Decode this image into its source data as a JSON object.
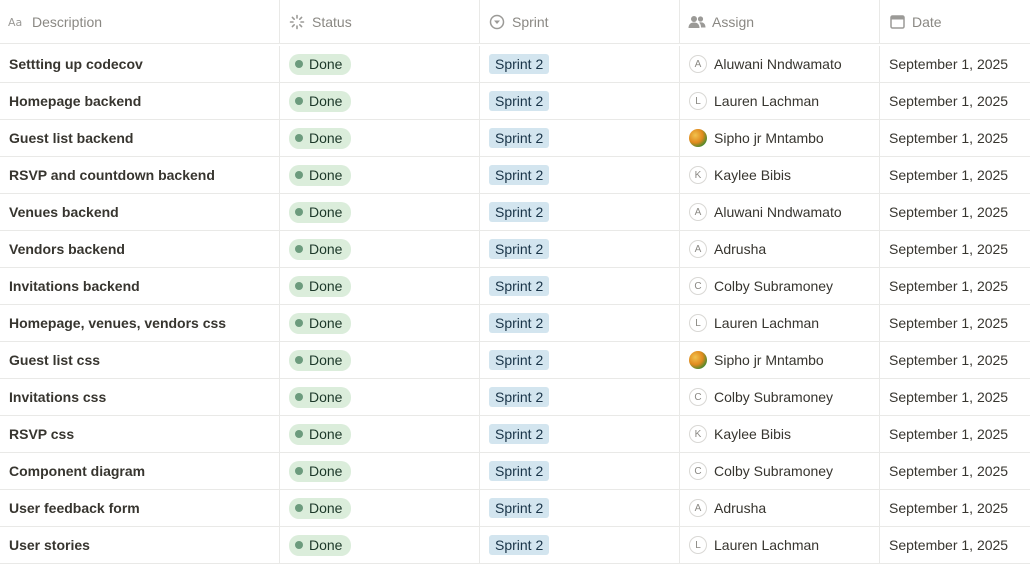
{
  "columns": {
    "description": "Description",
    "status": "Status",
    "sprint": "Sprint",
    "assign": "Assign",
    "date": "Date"
  },
  "rows": [
    {
      "description": "Settting up codecov",
      "status": "Done",
      "sprint": "Sprint 2",
      "initial": "A",
      "assignee": "Aluwani Nndwamato",
      "photo": false,
      "date": "September 1, 2025"
    },
    {
      "description": "Homepage backend",
      "status": "Done",
      "sprint": "Sprint 2",
      "initial": "L",
      "assignee": "Lauren Lachman",
      "photo": false,
      "date": "September 1, 2025"
    },
    {
      "description": "Guest list backend",
      "status": "Done",
      "sprint": "Sprint 2",
      "initial": "",
      "assignee": "Sipho jr Mntambo",
      "photo": true,
      "date": "September 1, 2025"
    },
    {
      "description": "RSVP and countdown backend",
      "status": "Done",
      "sprint": "Sprint 2",
      "initial": "K",
      "assignee": "Kaylee Bibis",
      "photo": false,
      "date": "September 1, 2025"
    },
    {
      "description": "Venues backend",
      "status": "Done",
      "sprint": "Sprint 2",
      "initial": "A",
      "assignee": "Aluwani Nndwamato",
      "photo": false,
      "date": "September 1, 2025"
    },
    {
      "description": "Vendors backend",
      "status": "Done",
      "sprint": "Sprint 2",
      "initial": "A",
      "assignee": "Adrusha",
      "photo": false,
      "date": "September 1, 2025"
    },
    {
      "description": "Invitations backend",
      "status": "Done",
      "sprint": "Sprint 2",
      "initial": "C",
      "assignee": "Colby Subramoney",
      "photo": false,
      "date": "September 1, 2025"
    },
    {
      "description": "Homepage, venues, vendors css",
      "status": "Done",
      "sprint": "Sprint 2",
      "initial": "L",
      "assignee": "Lauren Lachman",
      "photo": false,
      "date": "September 1, 2025"
    },
    {
      "description": "Guest list css",
      "status": "Done",
      "sprint": "Sprint 2",
      "initial": "",
      "assignee": "Sipho jr Mntambo",
      "photo": true,
      "date": "September 1, 2025"
    },
    {
      "description": "Invitations css",
      "status": "Done",
      "sprint": "Sprint 2",
      "initial": "C",
      "assignee": "Colby Subramoney",
      "photo": false,
      "date": "September 1, 2025"
    },
    {
      "description": "RSVP css",
      "status": "Done",
      "sprint": "Sprint 2",
      "initial": "K",
      "assignee": "Kaylee Bibis",
      "photo": false,
      "date": "September 1, 2025"
    },
    {
      "description": "Component diagram",
      "status": "Done",
      "sprint": "Sprint 2",
      "initial": "C",
      "assignee": "Colby Subramoney",
      "photo": false,
      "date": "September 1, 2025"
    },
    {
      "description": "User feedback form",
      "status": "Done",
      "sprint": "Sprint 2",
      "initial": "A",
      "assignee": "Adrusha",
      "photo": false,
      "date": "September 1, 2025"
    },
    {
      "description": "User stories",
      "status": "Done",
      "sprint": "Sprint 2",
      "initial": "L",
      "assignee": "Lauren Lachman",
      "photo": false,
      "date": "September 1, 2025"
    }
  ],
  "icons": {
    "description": "text-property-icon",
    "status": "status-loading-icon",
    "sprint": "select-circle-icon",
    "assign": "people-icon",
    "date": "calendar-icon"
  },
  "colors": {
    "status_done_bg": "#dbeddb",
    "status_done_dot": "#6c9b7d",
    "sprint_bg": "#d3e5ef"
  }
}
